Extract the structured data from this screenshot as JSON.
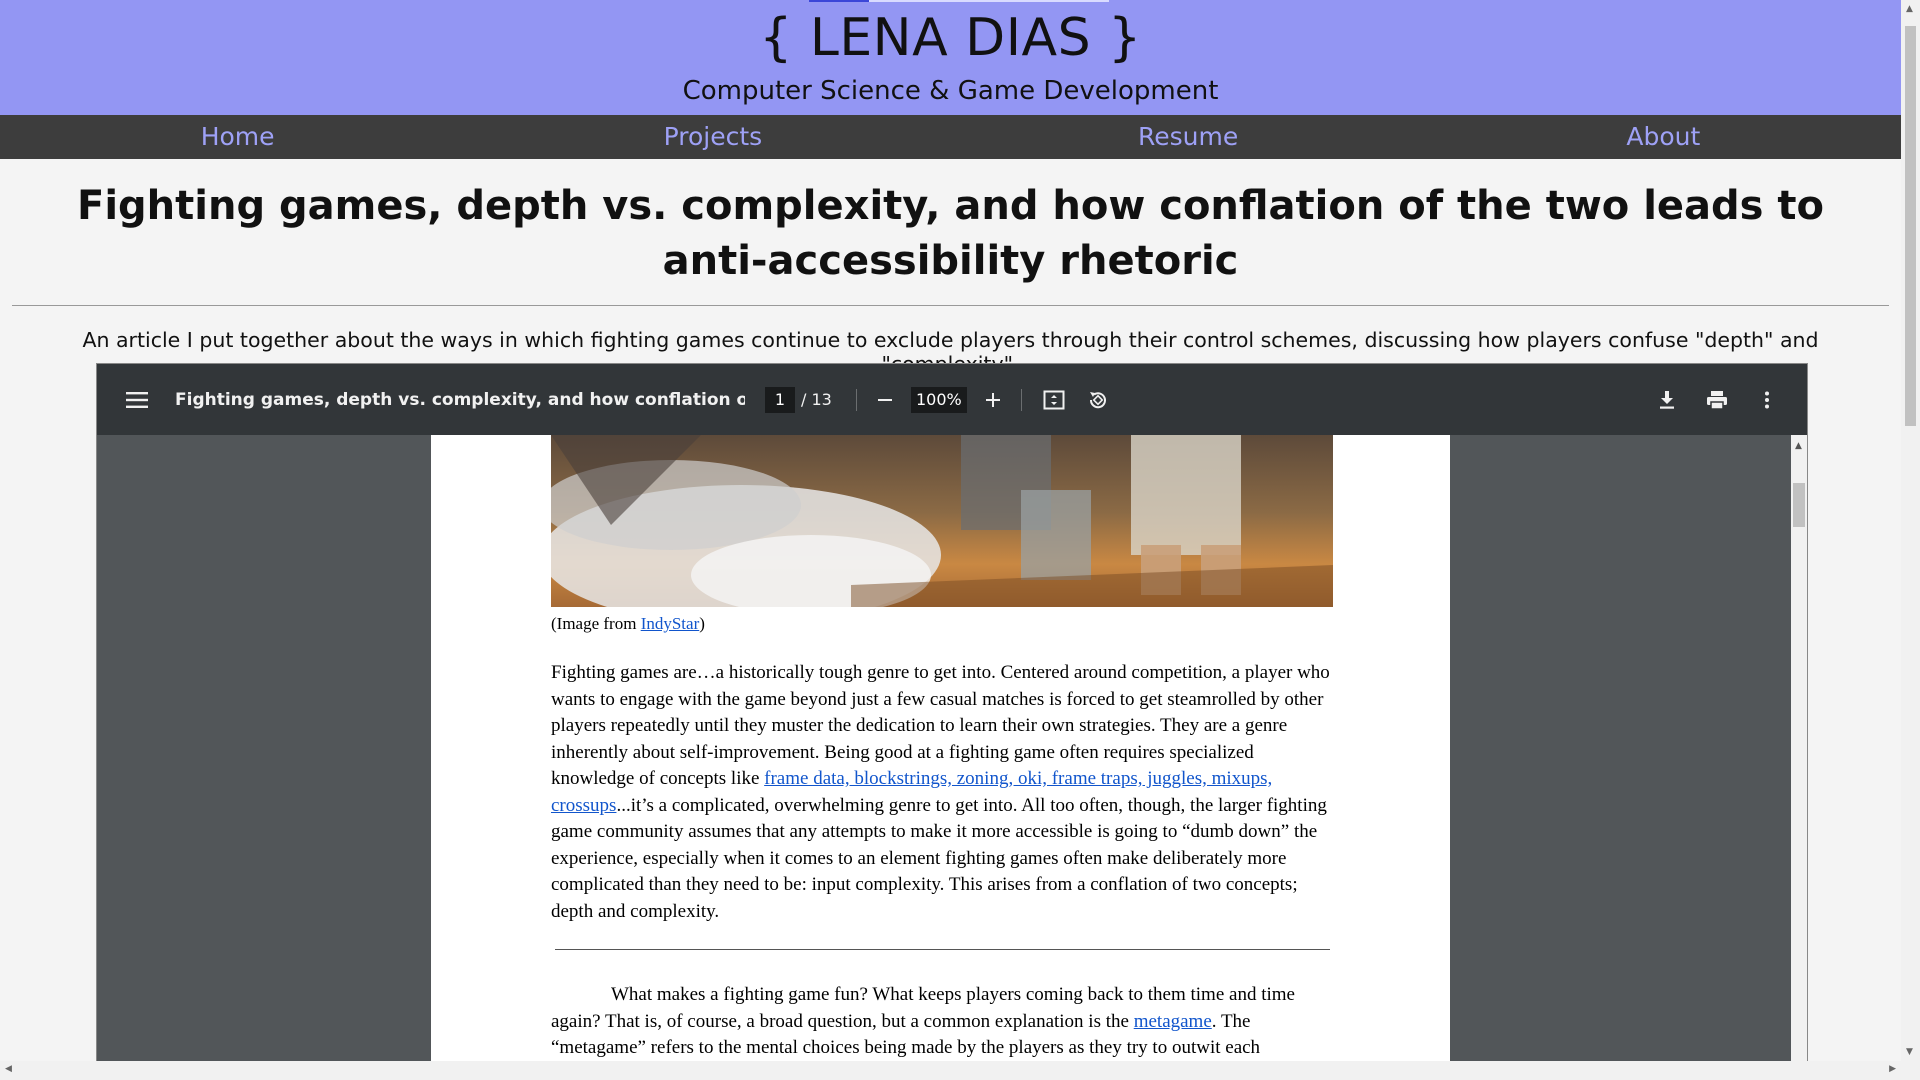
{
  "header": {
    "title": "{ LENA DIAS }",
    "subtitle": "Computer Science & Game Development"
  },
  "nav": {
    "items": [
      "Home",
      "Projects",
      "Resume",
      "About"
    ]
  },
  "article": {
    "title": "Fighting games, depth vs. complexity, and how conflation of the two leads to anti-accessibility rhetoric",
    "description": "An article I put together about the ways in which fighting games continue to exclude players through their control schemes, discussing how players confuse \"depth\" and \"complexity\"."
  },
  "pdf": {
    "toolbar": {
      "doc_title": "Fighting games, depth vs. complexity, and how conflation of the two le...",
      "page_current": "1",
      "page_total": "/ 13",
      "zoom": "100%",
      "icons": [
        "menu-icon",
        "minus-icon",
        "plus-icon",
        "fit-page-icon",
        "rotate-icon",
        "download-icon",
        "print-icon",
        "more-icon"
      ]
    },
    "caption": {
      "prefix": "(Image from ",
      "link": "IndyStar",
      "suffix": ")"
    },
    "para1": {
      "text_a": "Fighting games are…a historically tough genre to get into. Centered around competition, a player who wants to engage with the game beyond just a few casual matches is forced to get steamrolled by other players repeatedly until they muster the dedication to learn their own strategies. They are a genre inherently about self-improvement. Being good at a fighting game often requires specialized knowledge of concepts like ",
      "link": "frame data, blockstrings, zoning, oki, frame traps, juggles, mixups, crossups",
      "text_b": "...it’s a complicated, overwhelming genre to get into. All too often, though, the larger fighting game community assumes that any attempts to make it more accessible is going to “dumb down” the experience, especially when it comes to an element fighting games often make deliberately more complicated than they need to be: input complexity. This arises from a conflation of two concepts; depth and complexity."
    },
    "para2": {
      "text_a": "What makes a fighting game fun? What keeps players coming back to them time and time again? That is, of course, a broad question, but a common explanation is the ",
      "link": "metagame",
      "text_b": ". The “metagame” refers to the mental choices being made by the players as they try to outwit each"
    }
  }
}
